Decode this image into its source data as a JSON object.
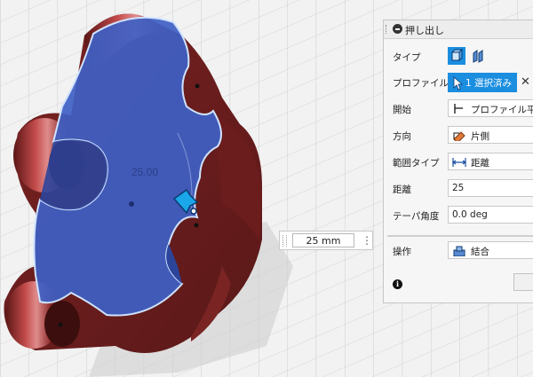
{
  "viewport": {
    "dimension_label": "25.00",
    "colors": {
      "body": "#8b2a2a",
      "selected_face": "#3a5cc0",
      "background": "#f4f4f4"
    }
  },
  "dimension_input": {
    "value": "25 mm",
    "menu_icon": "more-vertical-icon"
  },
  "panel": {
    "title": "押し出し",
    "rows": {
      "type": {
        "label": "タイプ"
      },
      "profile": {
        "label": "プロファイル",
        "value": "1 選択済み",
        "clear": "✕"
      },
      "start": {
        "label": "開始",
        "value": "プロファイル平面"
      },
      "direction": {
        "label": "方向",
        "value": "片側"
      },
      "extent": {
        "label": "範囲タイプ",
        "value": "距離"
      },
      "distance": {
        "label": "距離",
        "value": "25"
      },
      "taper": {
        "label": "テーパ角度",
        "value": "0.0 deg"
      },
      "operation": {
        "label": "操作",
        "value": "結合"
      }
    },
    "info_icon": "i",
    "colors": {
      "accent": "#1b8ee0"
    }
  }
}
